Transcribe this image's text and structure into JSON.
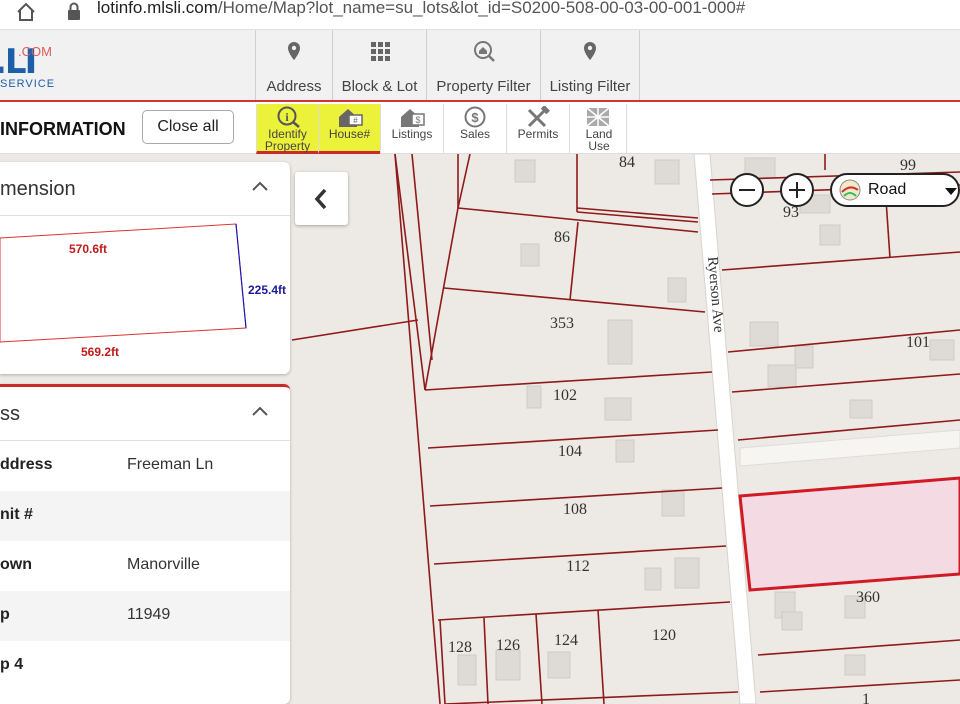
{
  "browser": {
    "url_host": "lotinfo.mlsli.com",
    "url_path": "/Home/Map?lot_name=su_lots&lot_id=S0200-508-00-03-00-001-000#"
  },
  "logo": {
    "big": ".LI",
    "com": ".COM",
    "service": "SERVICE"
  },
  "nav": [
    {
      "label": "Address",
      "icon": "map-pin-icon"
    },
    {
      "label": "Block & Lot",
      "icon": "grid-icon"
    },
    {
      "label": "Property Filter",
      "icon": "house-search-icon"
    },
    {
      "label": "Listing Filter",
      "icon": "map-pin-icon"
    }
  ],
  "toolbar": {
    "title": "INFORMATION",
    "close_all": "Close all",
    "tools": [
      {
        "label": "Identify Property",
        "icon": "identify-icon",
        "active": true
      },
      {
        "label": "House#",
        "icon": "house-number-icon",
        "active": true
      },
      {
        "label": "Listings",
        "icon": "listings-icon",
        "active": false
      },
      {
        "label": "Sales",
        "icon": "dollar-icon",
        "active": false
      },
      {
        "label": "Permits",
        "icon": "tools-icon",
        "active": false
      },
      {
        "label": "Land Use",
        "icon": "land-use-icon",
        "active": false
      }
    ]
  },
  "dimension_card": {
    "title": "mension",
    "top_length": "570.6ft",
    "side_length": "225.4ft",
    "bottom_length": "569.2ft"
  },
  "address_card": {
    "title": "ss",
    "rows": [
      {
        "key": "ddress",
        "value": "Freeman Ln"
      },
      {
        "key": "nit #",
        "value": ""
      },
      {
        "key": "own",
        "value": "Manorville"
      },
      {
        "key": "p",
        "value": "11949"
      },
      {
        "key": "p 4",
        "value": ""
      }
    ]
  },
  "map": {
    "basemap": "Road",
    "street_name": "Ryerson Ave",
    "lot_labels": [
      "84",
      "99",
      "93",
      "86",
      "353",
      "101",
      "102",
      "104",
      "108",
      "112",
      "360",
      "128",
      "126",
      "124",
      "120",
      "1"
    ],
    "colors": {
      "lot_line": "#8f1a1a",
      "highlight": "#d11a24",
      "highlight_fill": "#f4dbe3",
      "background": "#ede9e4"
    }
  }
}
